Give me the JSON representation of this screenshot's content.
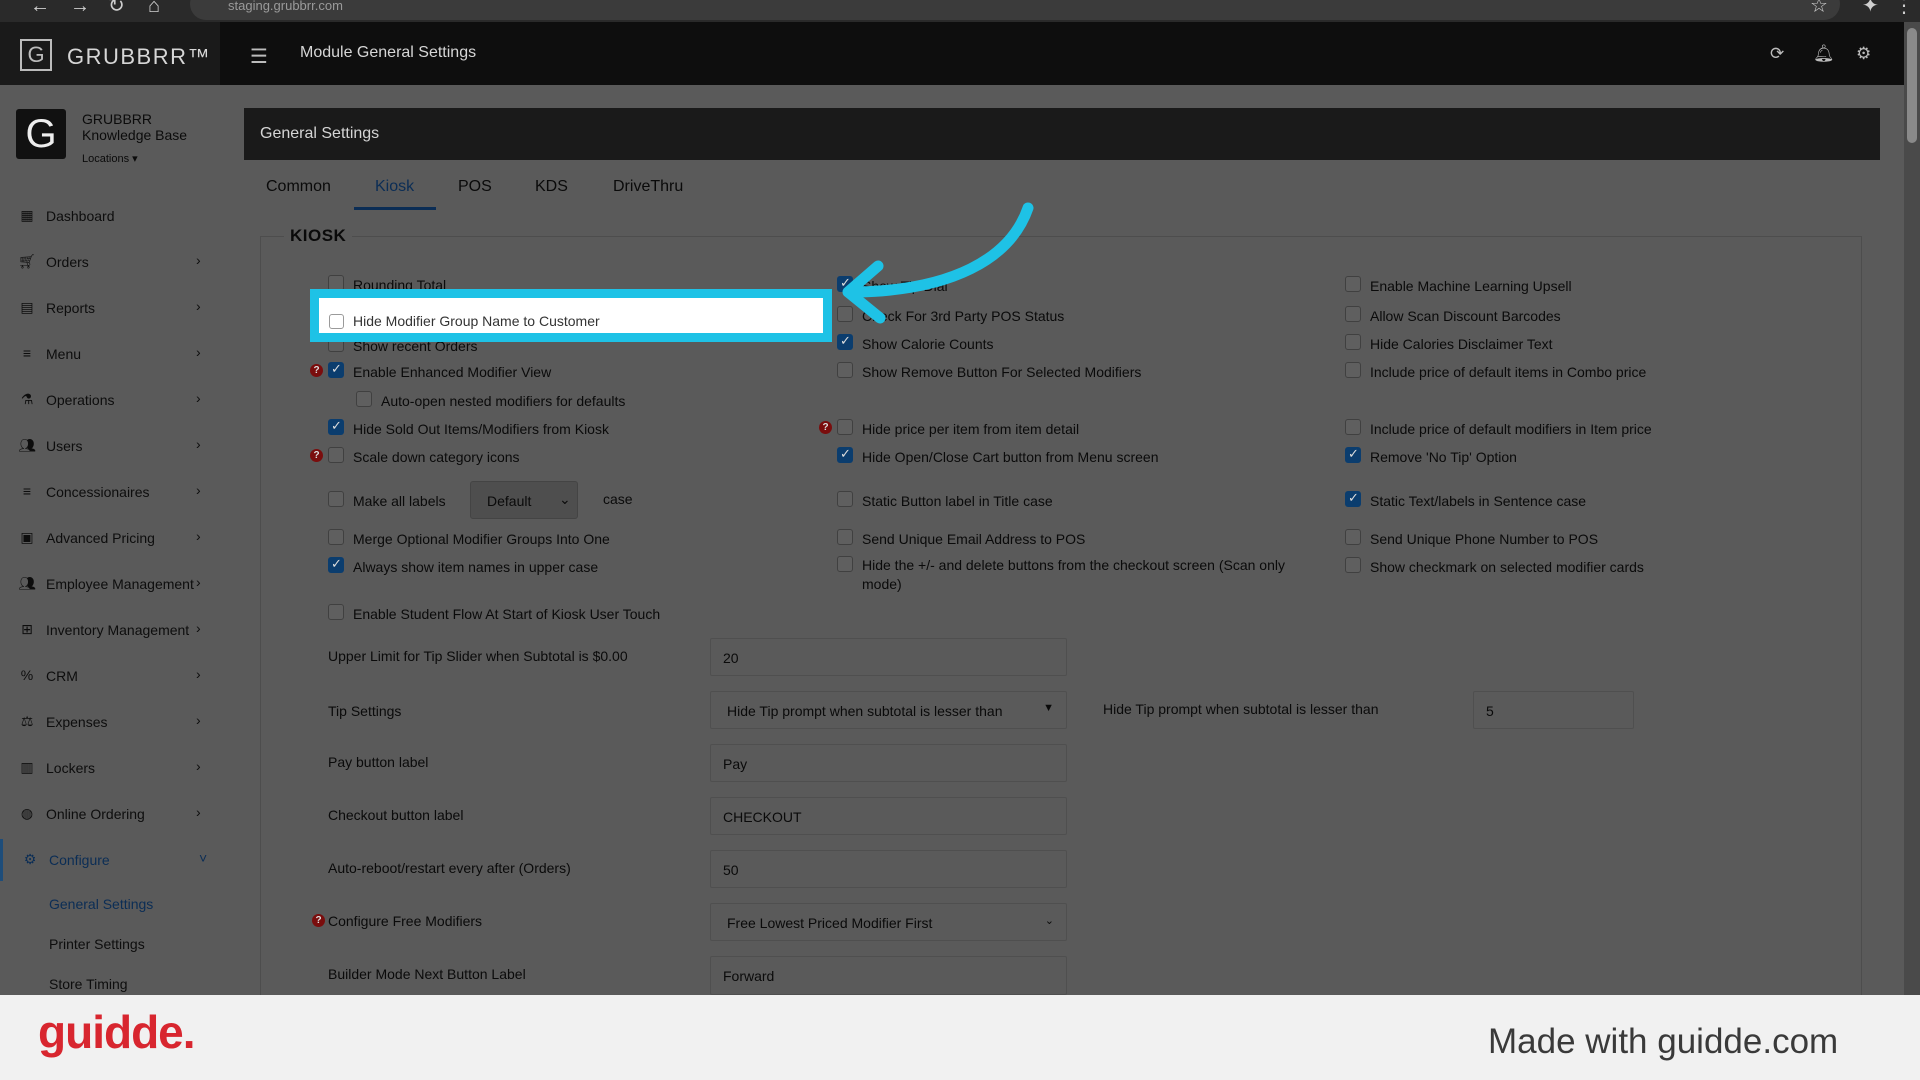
{
  "browser": {
    "url": "staging.grubbrr.com"
  },
  "header": {
    "logo_letter": "G",
    "logo_text": "GRUBBRR™",
    "module_title": "Module General Settings"
  },
  "sidebar": {
    "brand_letter": "G",
    "brand_name": "GRUBBRR Knowledge Base",
    "locations": "Locations ▾",
    "items": [
      {
        "label": "Dashboard"
      },
      {
        "label": "Orders"
      },
      {
        "label": "Reports"
      },
      {
        "label": "Menu"
      },
      {
        "label": "Operations"
      },
      {
        "label": "Users"
      },
      {
        "label": "Concessionaires"
      },
      {
        "label": "Advanced Pricing"
      },
      {
        "label": "Employee Management"
      },
      {
        "label": "Inventory Management"
      },
      {
        "label": "CRM"
      },
      {
        "label": "Expenses"
      },
      {
        "label": "Lockers"
      },
      {
        "label": "Online Ordering"
      },
      {
        "label": "Configure"
      }
    ],
    "sub_items": [
      {
        "label": "General Settings"
      },
      {
        "label": "Printer Settings"
      },
      {
        "label": "Store Timing"
      }
    ]
  },
  "card": {
    "title": "General Settings",
    "tabs": [
      {
        "label": "Common"
      },
      {
        "label": "Kiosk"
      },
      {
        "label": "POS"
      },
      {
        "label": "KDS"
      },
      {
        "label": "DriveThru"
      }
    ],
    "section": "KIOSK"
  },
  "options": {
    "col1": [
      {
        "label": "Rounding Total",
        "checked": false
      },
      {
        "label": "Hide Modifier Group Name to Customer",
        "checked": false
      },
      {
        "label": "Show recent Orders",
        "checked": false
      },
      {
        "label": "Enable Enhanced Modifier View",
        "checked": true
      },
      {
        "label": "Auto-open nested modifiers for defaults",
        "checked": false
      },
      {
        "label": "Hide Sold Out Items/Modifiers from Kiosk",
        "checked": true
      },
      {
        "label": "Scale down category icons",
        "checked": false
      },
      {
        "label": "Make all labels",
        "checked": false
      },
      {
        "label": "Merge Optional Modifier Groups Into One",
        "checked": false
      },
      {
        "label": "Always show item names in upper case",
        "checked": true
      },
      {
        "label": "Enable Student Flow At Start of Kiosk User Touch",
        "checked": false
      }
    ],
    "labels_select": "Default",
    "labels_suffix": "case",
    "col2": [
      {
        "label": "Show Tip Dial",
        "checked": true
      },
      {
        "label": "Check For 3rd Party POS Status",
        "checked": false
      },
      {
        "label": "Show Calorie Counts",
        "checked": true
      },
      {
        "label": "Show Remove Button For Selected Modifiers",
        "checked": false
      },
      {
        "label": "Hide price per item from item detail",
        "checked": false
      },
      {
        "label": "Hide Open/Close Cart button from Menu screen",
        "checked": true
      },
      {
        "label": "Static Button label in Title case",
        "checked": false
      },
      {
        "label": "Send Unique Email Address to POS",
        "checked": false
      },
      {
        "label": "Hide the +/- and delete buttons from the checkout screen (Scan only mode)",
        "checked": false
      }
    ],
    "col3": [
      {
        "label": "Enable Machine Learning Upsell",
        "checked": false
      },
      {
        "label": "Allow Scan Discount Barcodes",
        "checked": false
      },
      {
        "label": "Hide Calories Disclaimer Text",
        "checked": false
      },
      {
        "label": "Include price of default items in Combo price",
        "checked": false
      },
      {
        "label": "Include price of default modifiers in Item price",
        "checked": false
      },
      {
        "label": "Remove 'No Tip' Option",
        "checked": true
      },
      {
        "label": "Static Text/labels in Sentence case",
        "checked": true
      },
      {
        "label": "Send Unique Phone Number to POS",
        "checked": false
      },
      {
        "label": "Show checkmark on selected modifier cards",
        "checked": false
      }
    ]
  },
  "fields": {
    "tip_slider": {
      "label": "Upper Limit for Tip Slider when Subtotal is $0.00",
      "value": "20"
    },
    "tip_settings": {
      "label": "Tip Settings",
      "value": "Hide Tip prompt when subtotal is lesser than"
    },
    "tip_threshold": {
      "label": "Hide Tip prompt when subtotal is lesser than",
      "value": "5"
    },
    "pay_button": {
      "label": "Pay button label",
      "value": "Pay"
    },
    "checkout_button": {
      "label": "Checkout button label",
      "value": "CHECKOUT"
    },
    "auto_reboot": {
      "label": "Auto-reboot/restart every after (Orders)",
      "value": "50"
    },
    "free_modifiers": {
      "label": "Configure Free Modifiers",
      "value": "Free Lowest Priced Modifier First"
    },
    "builder_next": {
      "label": "Builder Mode Next Button Label",
      "value": "Forward"
    }
  },
  "footer": {
    "brand": "guidde.",
    "made_with": "Made with guidde.com"
  },
  "colors": {
    "highlight": "#1ec2e6",
    "accent": "#0b2d55",
    "brand_red": "#d8262f"
  }
}
